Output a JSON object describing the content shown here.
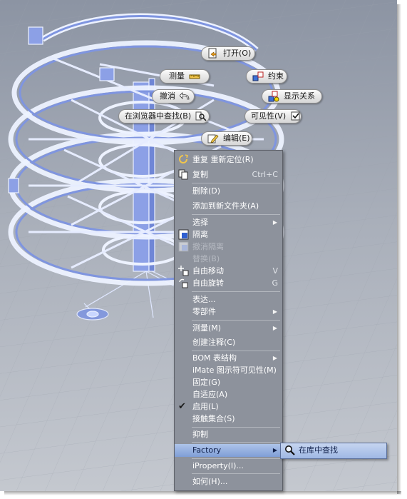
{
  "marking_menu": {
    "open": "打开(O)",
    "measure": "测量",
    "constraint": "约束",
    "undo": "撤消",
    "show_relations": "显示关系",
    "find_in_browser": "在浏览器中查找(B)",
    "visibility": "可见性(V)",
    "edit": "编辑(E)"
  },
  "context_menu": {
    "items": [
      {
        "label": "重复 重新定位(R)"
      },
      {
        "label": "复制",
        "shortcut": "Ctrl+C"
      },
      {
        "label": "删除(D)"
      },
      {
        "label": "添加到新文件夹(A)"
      },
      {
        "label": "选择"
      },
      {
        "label": "隔离"
      },
      {
        "label": "撤消隔离"
      },
      {
        "label": "替换(B)"
      },
      {
        "label": "自由移动",
        "shortcut": "V"
      },
      {
        "label": "自由旋转",
        "shortcut": "G"
      },
      {
        "label": "表达..."
      },
      {
        "label": "零部件"
      },
      {
        "label": "测量(M)"
      },
      {
        "label": "创建注释(C)"
      },
      {
        "label": "BOM 表结构"
      },
      {
        "label": "iMate 图示符可见性(M)"
      },
      {
        "label": "固定(G)"
      },
      {
        "label": "自适应(A)"
      },
      {
        "label": "启用(L)"
      },
      {
        "label": "接触集合(S)"
      },
      {
        "label": "抑制"
      },
      {
        "label": "Factory"
      },
      {
        "label": "iProperty(I)..."
      },
      {
        "label": "如何(H)..."
      }
    ]
  },
  "submenu": {
    "find_in_library": "在库中查找"
  },
  "colors": {
    "viewport_top": "#8c94a3",
    "model_wire": "#c9d6ff",
    "model_fill": "#7f95e0",
    "menu_bg": "#8d929c",
    "highlight": "#9fb8e4"
  }
}
